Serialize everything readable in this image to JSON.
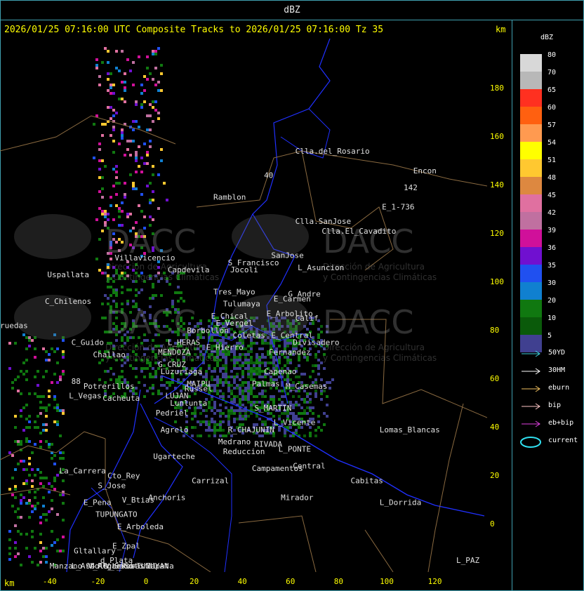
{
  "title_bar": "dBZ",
  "header": {
    "text": "2026/01/25 07:16:00 UTC Composite Tracks to 2026/01/25 07:16:00 Tz 35",
    "km_top": "km",
    "km_bottom": "km"
  },
  "axes": {
    "y_ticks": [
      {
        "label": "180",
        "value": 180
      },
      {
        "label": "160",
        "value": 160
      },
      {
        "label": "140",
        "value": 140
      },
      {
        "label": "120",
        "value": 120
      },
      {
        "label": "100",
        "value": 100
      },
      {
        "label": "80",
        "value": 80
      },
      {
        "label": "60",
        "value": 60
      },
      {
        "label": "40",
        "value": 40
      },
      {
        "label": "20",
        "value": 20
      },
      {
        "label": "0",
        "value": 0
      }
    ],
    "x_ticks": [
      {
        "label": "-40",
        "value": -40
      },
      {
        "label": "-20",
        "value": -20
      },
      {
        "label": "0",
        "value": 0
      },
      {
        "label": "20",
        "value": 20
      },
      {
        "label": "40",
        "value": 40
      },
      {
        "label": "60",
        "value": 60
      },
      {
        "label": "80",
        "value": 80
      },
      {
        "label": "100",
        "value": 100
      },
      {
        "label": "120",
        "value": 120
      }
    ]
  },
  "places": [
    {
      "name": "Clla.del_Rosario",
      "x": 62,
      "y": 153
    },
    {
      "name": "Encon",
      "x": 111,
      "y": 145
    },
    {
      "name": "142",
      "x": 107,
      "y": 138
    },
    {
      "name": "E_1-736",
      "x": 98,
      "y": 130
    },
    {
      "name": "Ramblon",
      "x": 28,
      "y": 134
    },
    {
      "name": "Clla.SanJose",
      "x": 62,
      "y": 124
    },
    {
      "name": "Clla.El_Cavadito",
      "x": 73,
      "y": 120
    },
    {
      "name": "Villavicencio",
      "x": -13,
      "y": 109
    },
    {
      "name": "S_Francisco",
      "x": 34,
      "y": 107
    },
    {
      "name": "SanJose",
      "x": 52,
      "y": 110
    },
    {
      "name": "Uspallata",
      "x": -41,
      "y": 102
    },
    {
      "name": "Jocoli",
      "x": 35,
      "y": 104
    },
    {
      "name": "Capdevila",
      "x": 9,
      "y": 104
    },
    {
      "name": "L_Asuncion",
      "x": 63,
      "y": 105
    },
    {
      "name": "Tres_Mayo",
      "x": 28,
      "y": 95
    },
    {
      "name": "G_Andre",
      "x": 59,
      "y": 94
    },
    {
      "name": "C_Chilenos",
      "x": -42,
      "y": 91
    },
    {
      "name": "Tulumaya",
      "x": 32,
      "y": 90
    },
    {
      "name": "E_Carmen",
      "x": 53,
      "y": 92
    },
    {
      "name": "E_Chical",
      "x": 27,
      "y": 85
    },
    {
      "name": "E_Arbolito",
      "x": 50,
      "y": 86
    },
    {
      "name": "Calif",
      "x": 62,
      "y": 84
    },
    {
      "name": "E_Vergel",
      "x": 29,
      "y": 82
    },
    {
      "name": "Borbollon",
      "x": 17,
      "y": 79
    },
    {
      "name": "Coletas",
      "x": 36,
      "y": 77
    },
    {
      "name": "E_Central",
      "x": 52,
      "y": 77
    },
    {
      "name": "Divisadero",
      "x": 61,
      "y": 74
    },
    {
      "name": "ruedas",
      "x": -61,
      "y": 81
    },
    {
      "name": "C_Guido",
      "x": -31,
      "y": 74
    },
    {
      "name": "L_HERAS",
      "x": 9,
      "y": 74
    },
    {
      "name": "E_Hierro",
      "x": 25,
      "y": 72
    },
    {
      "name": "Challao",
      "x": -22,
      "y": 69
    },
    {
      "name": "MENDOZA",
      "x": 5,
      "y": 70
    },
    {
      "name": "G_CRUZ",
      "x": 5,
      "y": 65
    },
    {
      "name": "Fernandez",
      "x": 51,
      "y": 70
    },
    {
      "name": "Luzuriaga",
      "x": 6,
      "y": 62
    },
    {
      "name": "Capenao",
      "x": 49,
      "y": 62
    },
    {
      "name": "Potrerillos",
      "x": -26,
      "y": 56
    },
    {
      "name": "MAIPU",
      "x": 17,
      "y": 57
    },
    {
      "name": "Palmas",
      "x": 44,
      "y": 57
    },
    {
      "name": "M_Casemas",
      "x": 58,
      "y": 56
    },
    {
      "name": "88",
      "x": -31,
      "y": 58
    },
    {
      "name": "L_Vegas",
      "x": -32,
      "y": 52
    },
    {
      "name": "Cacheuta",
      "x": -18,
      "y": 51
    },
    {
      "name": "Russel",
      "x": 16,
      "y": 55
    },
    {
      "name": "LUJAN",
      "x": 8,
      "y": 52
    },
    {
      "name": "Lunlunta",
      "x": 10,
      "y": 49
    },
    {
      "name": "Pedriel",
      "x": 4,
      "y": 45
    },
    {
      "name": "S_MARTIN",
      "x": 45,
      "y": 47
    },
    {
      "name": "Agrelo",
      "x": 6,
      "y": 38
    },
    {
      "name": "L_Vicente",
      "x": 53,
      "y": 41
    },
    {
      "name": "R_CHAJUNIN",
      "x": 34,
      "y": 38
    },
    {
      "name": "Medrano",
      "x": 30,
      "y": 33
    },
    {
      "name": "RIVADA",
      "x": 45,
      "y": 32
    },
    {
      "name": "L_PONTE",
      "x": 55,
      "y": 30
    },
    {
      "name": "Ugarteche",
      "x": 3,
      "y": 27
    },
    {
      "name": "Reduccion",
      "x": 32,
      "y": 29
    },
    {
      "name": "La_Carrera",
      "x": -36,
      "y": 21
    },
    {
      "name": "Cto_Rey",
      "x": -16,
      "y": 19
    },
    {
      "name": "S_Jose",
      "x": -20,
      "y": 15
    },
    {
      "name": "Carrizal",
      "x": 19,
      "y": 17
    },
    {
      "name": "Campamentos",
      "x": 44,
      "y": 22
    },
    {
      "name": "Central",
      "x": 61,
      "y": 23
    },
    {
      "name": "Lomas_Blancas",
      "x": 97,
      "y": 38
    },
    {
      "name": "Cabitas",
      "x": 85,
      "y": 17
    },
    {
      "name": "E_Pena",
      "x": -26,
      "y": 8
    },
    {
      "name": "V_Btias",
      "x": -10,
      "y": 9
    },
    {
      "name": "Anchoris",
      "x": 1,
      "y": 10
    },
    {
      "name": "Mirador",
      "x": 56,
      "y": 10
    },
    {
      "name": "TUPUNGATO",
      "x": -21,
      "y": 3
    },
    {
      "name": "E_Arboleda",
      "x": -12,
      "y": -2
    },
    {
      "name": "L_Dorrida",
      "x": 97,
      "y": 8
    },
    {
      "name": "Gltallary",
      "x": -30,
      "y": -12
    },
    {
      "name": "E_Zpal",
      "x": -14,
      "y": -10
    },
    {
      "name": "d_Plata",
      "x": -19,
      "y": -16
    },
    {
      "name": "L_Arbols",
      "x": -31,
      "y": -21
    },
    {
      "name": "Zapata",
      "x": 0,
      "y": -24
    },
    {
      "name": "L_PAZ",
      "x": 131,
      "y": -16
    },
    {
      "name": "Algarrob",
      "x": -20,
      "y": -27
    },
    {
      "name": "V_Seco",
      "x": -17,
      "y": -31
    },
    {
      "name": "Sotoral",
      "x": -9,
      "y": -32
    },
    {
      "name": "TUNUYAN",
      "x": -4,
      "y": -35
    },
    {
      "name": "Manzano",
      "x": -40,
      "y": -41
    },
    {
      "name": "94",
      "x": -25,
      "y": -42
    },
    {
      "name": "C_L_Rosas",
      "x": -18,
      "y": -43
    },
    {
      "name": "V_Flores",
      "x": -24,
      "y": -54
    },
    {
      "name": "40",
      "x": 49,
      "y": 143
    }
  ],
  "watermarks": [
    {
      "brand": "DACC",
      "line1": "Dirección de Agricultura",
      "line2": "y Contingencias Climáticas"
    },
    {
      "brand": "DACC",
      "line1": "Dirección de Agricultura",
      "line2": "y Contingencias Climáticas"
    },
    {
      "brand": "DACC",
      "line1": "Dirección de Agricultura",
      "line2": "y Contingencias Climáticas"
    },
    {
      "brand": "DACC",
      "line1": "Dirección de Agricultura",
      "line2": "y Contingencias Climáticas"
    }
  ],
  "legend": {
    "title": "dBZ",
    "scale": [
      {
        "label": "80",
        "color": "#d8d8d8"
      },
      {
        "label": "70",
        "color": "#b8b8b8"
      },
      {
        "label": "65",
        "color": "#ff3020"
      },
      {
        "label": "60",
        "color": "#ff6010"
      },
      {
        "label": "57",
        "color": "#ff9a50"
      },
      {
        "label": "54",
        "color": "#ffff00"
      },
      {
        "label": "51",
        "color": "#ffc830"
      },
      {
        "label": "48",
        "color": "#dd8840"
      },
      {
        "label": "45",
        "color": "#e070a0"
      },
      {
        "label": "42",
        "color": "#c070a0"
      },
      {
        "label": "39",
        "color": "#d0109a"
      },
      {
        "label": "36",
        "color": "#7010d0"
      },
      {
        "label": "35",
        "color": "#2050f0"
      },
      {
        "label": "30",
        "color": "#1080d0"
      },
      {
        "label": "20",
        "color": "#107810"
      },
      {
        "label": "10",
        "color": "#0a5a0a"
      },
      {
        "label": "5",
        "color": "#404090"
      }
    ],
    "tracks": [
      {
        "label": "50YD",
        "color": "#40d0e0",
        "kind": "arrow"
      },
      {
        "label": "30HM",
        "color": "#ffffff",
        "kind": "arrow"
      },
      {
        "label": "eburn",
        "color": "#f0c060",
        "kind": "arrow"
      },
      {
        "label": "bip",
        "color": "#ffc8c8",
        "kind": "arrow"
      },
      {
        "label": "eb+bip",
        "color": "#e040e0",
        "kind": "arrow"
      },
      {
        "label": "current",
        "color": "#30e0f0",
        "kind": "ellipse"
      }
    ]
  },
  "colors": {
    "border": "#3fa0b0",
    "axis_text": "#ffff00",
    "roads": "#2030ff",
    "boundaries": "#8a6a40"
  }
}
